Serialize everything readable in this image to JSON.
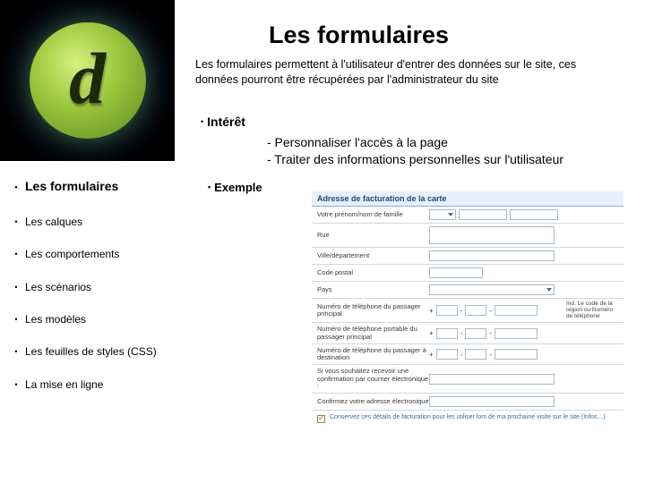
{
  "title": "Les formulaires",
  "intro": "Les formulaires permettent à l'utilisateur d'entrer des données sur le site, ces données pourront être récupérées par l'administrateur du site",
  "sections": {
    "interet": {
      "heading": "Intérêt",
      "line1": "- Personnaliser l'accès à la page",
      "line2": "- Traiter des informations personnelles sur l'utilisateur"
    },
    "exemple": {
      "heading": "Exemple"
    }
  },
  "sidebar": {
    "items": [
      {
        "label": "Les formulaires",
        "active": true
      },
      {
        "label": "Les calques"
      },
      {
        "label": "Les comportements"
      },
      {
        "label": "Les scénarios"
      },
      {
        "label": "Les modèles"
      },
      {
        "label": "Les feuilles de styles (CSS)"
      },
      {
        "label": "La mise en ligne"
      }
    ]
  },
  "form": {
    "header": "Adresse de facturation de la carte",
    "rows": {
      "name": "Votre prénom/nom de famille",
      "street": "Rue",
      "city": "Ville/département",
      "postal": "Code postal",
      "country": "Pays",
      "phone_main": "Numéro de téléphone du passager principal",
      "phone_mobile": "Numéro de téléphone portable du passager principal",
      "phone_dest": "Numéro de téléphone du passager à destination",
      "email_prompt": "Si vous souhaitez recevoir une confirmation par courrier électronique :",
      "email_confirm": "Confirmez votre adresse électronique"
    },
    "side_note": "Ind. Le code de la région ou Numéro de téléphone",
    "footer_note": "Conservez ces détails de facturation pour les utiliser lors de ma prochaine visite sur le site (Infos…)"
  }
}
